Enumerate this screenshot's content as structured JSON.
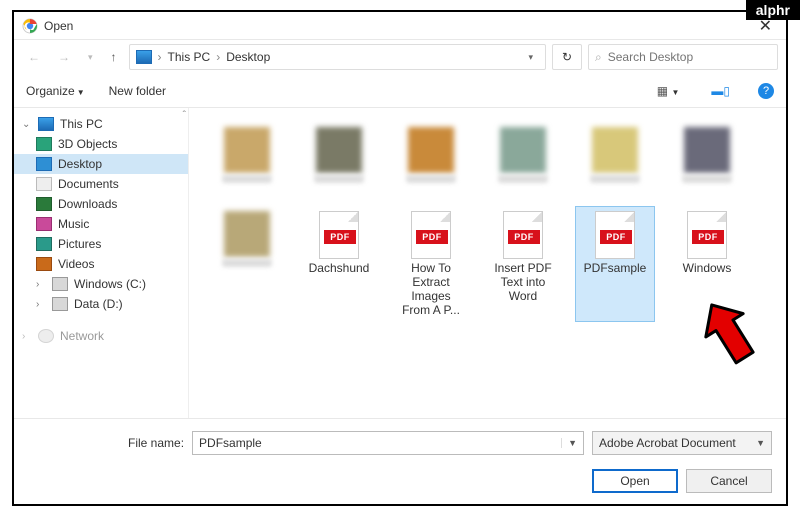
{
  "watermark": "alphr",
  "title": "Open",
  "breadcrumb": {
    "root": "This PC",
    "leaf": "Desktop"
  },
  "search": {
    "placeholder": "Search Desktop"
  },
  "toolbar": {
    "organize": "Organize",
    "newfolder": "New folder"
  },
  "tree": {
    "root": "This PC",
    "items": [
      {
        "label": "3D Objects"
      },
      {
        "label": "Desktop"
      },
      {
        "label": "Documents"
      },
      {
        "label": "Downloads"
      },
      {
        "label": "Music"
      },
      {
        "label": "Pictures"
      },
      {
        "label": "Videos"
      },
      {
        "label": "Windows (C:)"
      },
      {
        "label": "Data (D:)"
      }
    ],
    "network": "Network"
  },
  "files": {
    "pdfs": [
      {
        "label": "Dachshund"
      },
      {
        "label": "How To Extract Images From A P..."
      },
      {
        "label": "Insert PDF Text into Word"
      },
      {
        "label": "PDFsample"
      },
      {
        "label": "Windows"
      }
    ]
  },
  "footer": {
    "filename_label": "File name:",
    "filename_value": "PDFsample",
    "filter": "Adobe Acrobat Document",
    "open": "Open",
    "cancel": "Cancel"
  }
}
